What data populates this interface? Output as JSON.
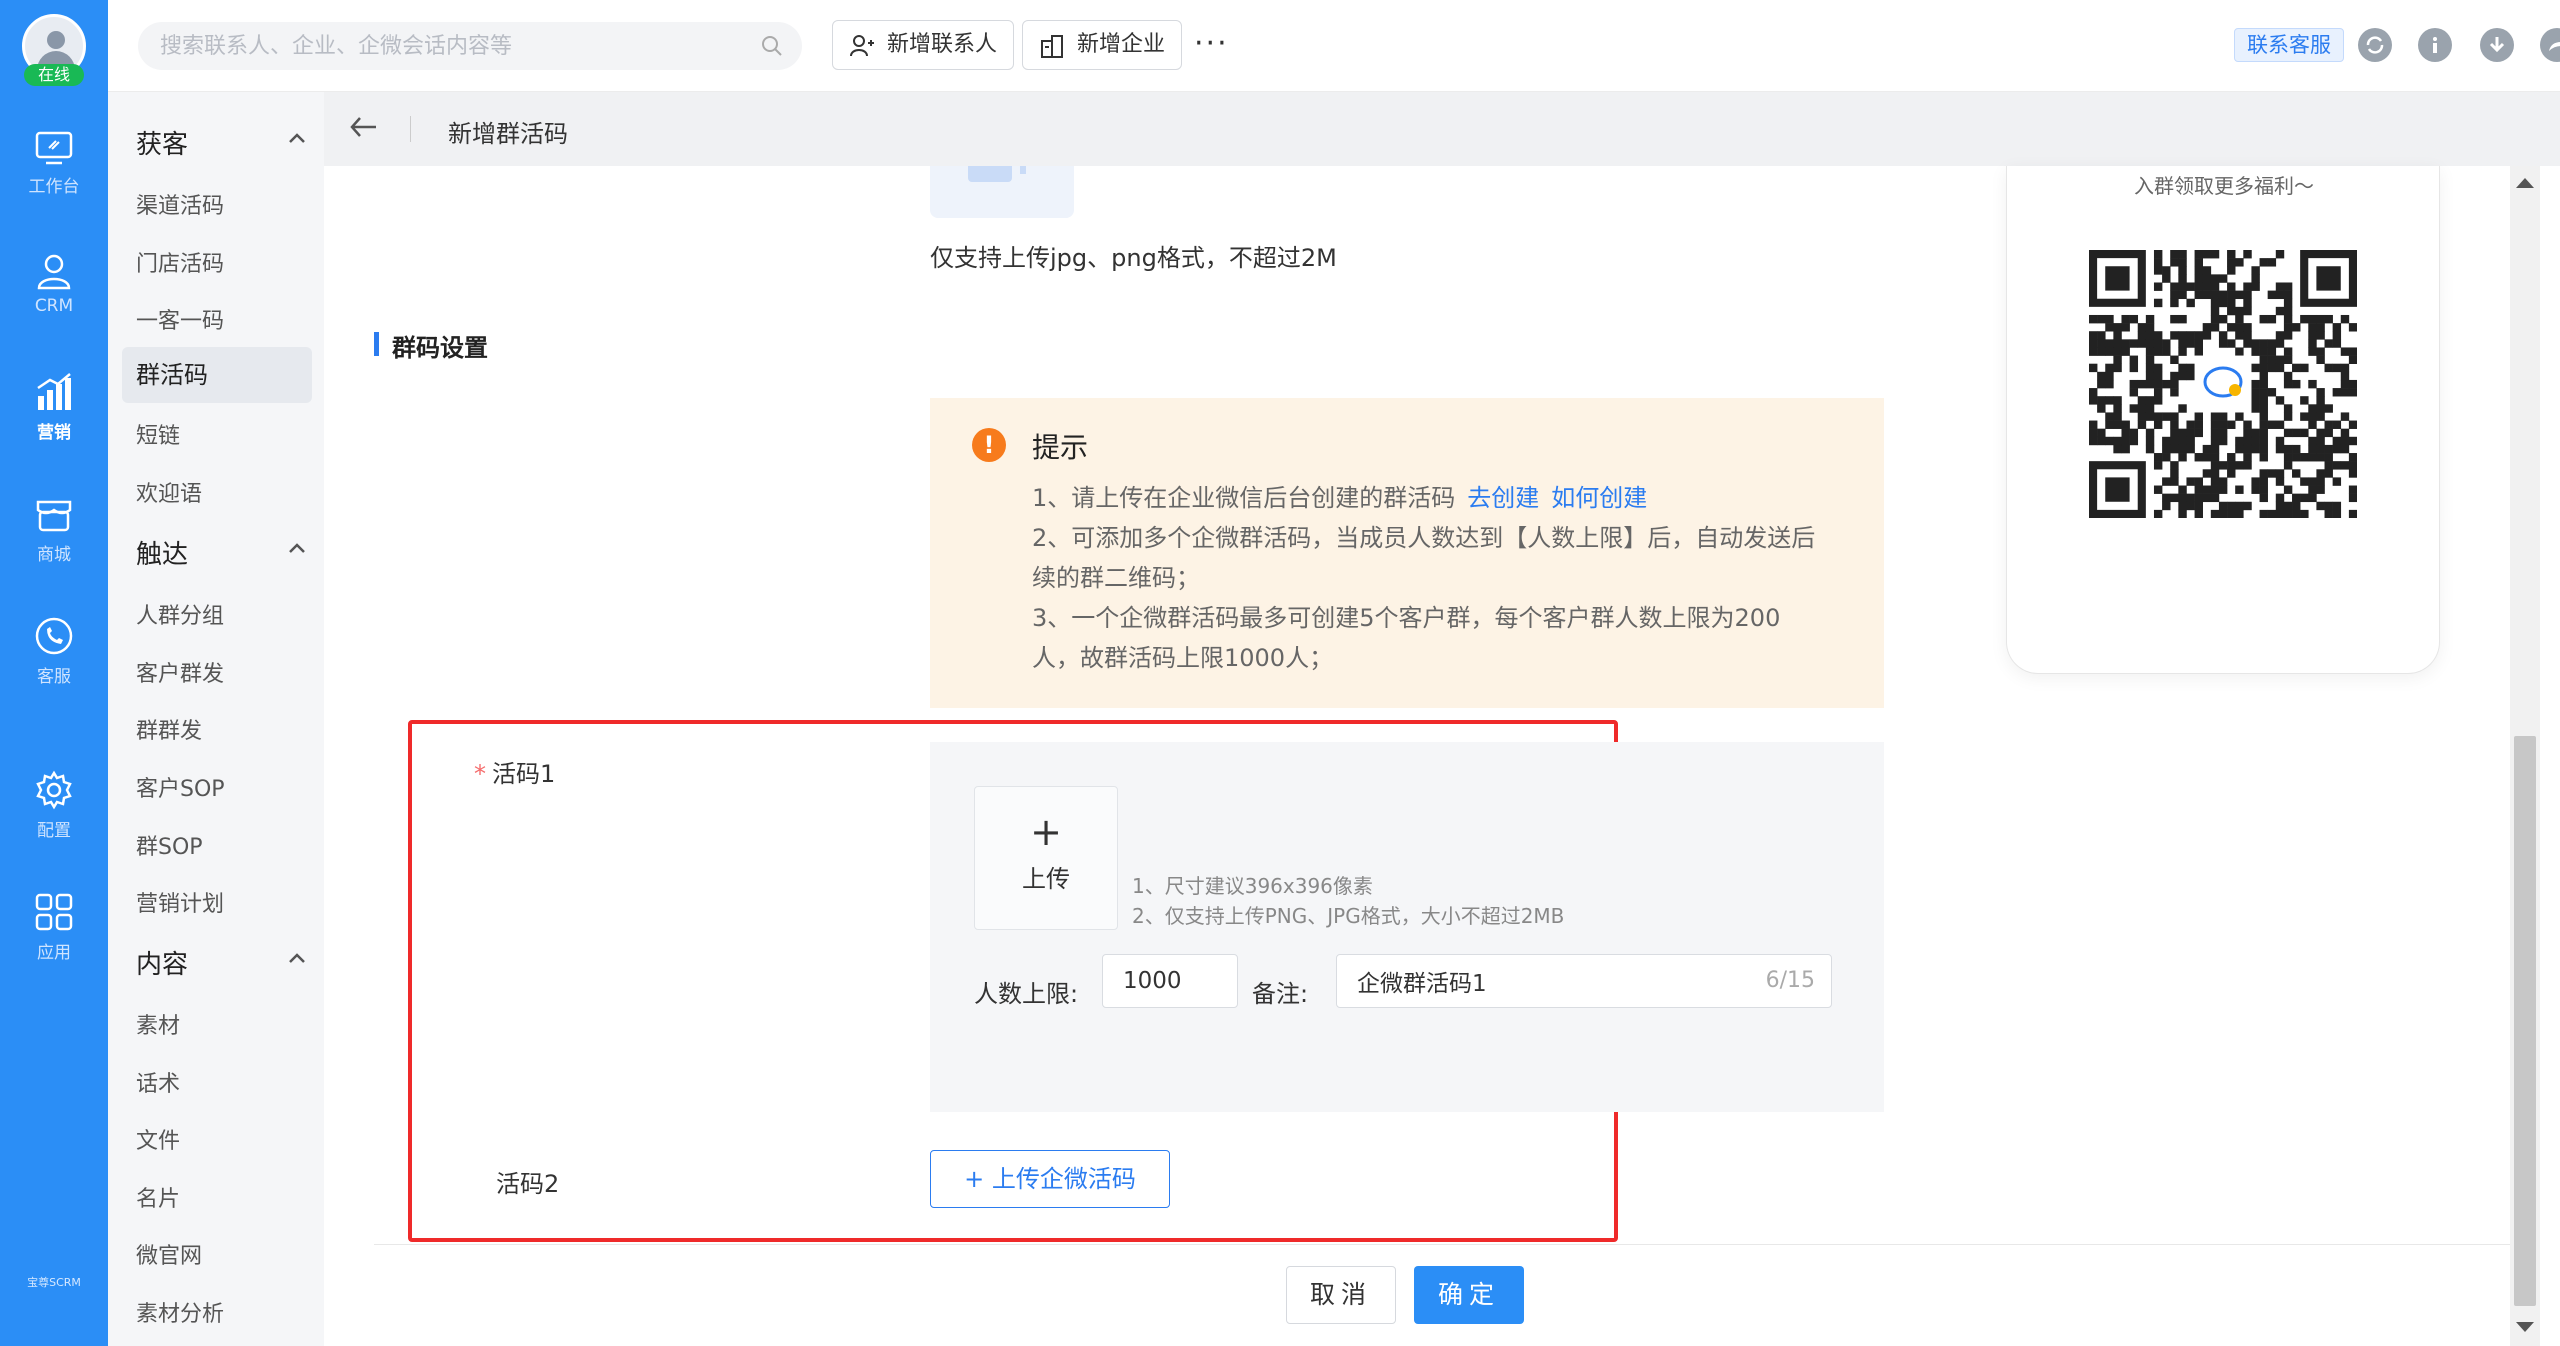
{
  "rail": {
    "status": "在线",
    "items": [
      {
        "label": "工作台",
        "icon": "monitor-icon"
      },
      {
        "label": "CRM",
        "icon": "user-icon"
      },
      {
        "label": "营销",
        "icon": "chart-up-icon"
      },
      {
        "label": "商城",
        "icon": "store-icon"
      },
      {
        "label": "客服",
        "icon": "phone-chat-icon"
      },
      {
        "label": "配置",
        "icon": "gear-icon"
      },
      {
        "label": "应用",
        "icon": "apps-grid-icon"
      }
    ],
    "logo": "宝尊SCRM",
    "active": "营销"
  },
  "topbar": {
    "search_placeholder": "搜索联系人、企业、企微会话内容等",
    "add_contact": "新增联系人",
    "add_company": "新增企业",
    "more": "···",
    "service": "联系客服"
  },
  "sidemenu": {
    "groups": [
      {
        "title": "获客",
        "items": [
          "渠道活码",
          "门店活码",
          "一客一码",
          "群活码",
          "短链",
          "欢迎语"
        ]
      },
      {
        "title": "触达",
        "items": [
          "人群分组",
          "客户群发",
          "群群发",
          "客户SOP",
          "群SOP",
          "营销计划"
        ]
      },
      {
        "title": "内容",
        "items": [
          "素材",
          "话术",
          "文件",
          "名片",
          "微官网",
          "素材分析"
        ]
      }
    ],
    "active": "群活码"
  },
  "breadcrumb": {
    "title": "新增群活码"
  },
  "form": {
    "upload_note": "仅支持上传jpg、png格式，不超过2M",
    "section_title": "群码设置",
    "tip": {
      "title": "提示",
      "line1": "1、请上传在企业微信后台创建的群活码",
      "link1": "去创建",
      "link2": "如何创建",
      "line2a": "2、可添加多个企微群活码，当成员人数达到【人数上限】后，自动发送后",
      "line2b": "续的群二维码；",
      "line3a": "3、一个企微群活码最多可创建5个客户群，每个客户群人数上限为200",
      "line3b": "人，故群活码上限1000人；"
    },
    "code1_label": "活码1",
    "required_mark": "*",
    "upload_plus": "+",
    "upload_label": "上传",
    "hint1": "1、尺寸建议396x396像素",
    "hint2": "2、仅支持上传PNG、JPG格式，大小不超过2MB",
    "limit_label": "人数上限:",
    "limit_value": "1000",
    "remark_label": "备注:",
    "remark_value": "企微群活码1",
    "remark_count": "6/15",
    "code2_label": "活码2",
    "upload_code_button": "+ 上传企微活码",
    "cancel": "取消",
    "confirm": "确定"
  },
  "preview": {
    "caption": "入群领取更多福利～"
  },
  "colors": {
    "rail": "#2b8ef6",
    "accent": "#2b7cf0",
    "tip_bg": "#fdf3e5",
    "highlight": "#ef2a2a",
    "online": "#19b955"
  }
}
